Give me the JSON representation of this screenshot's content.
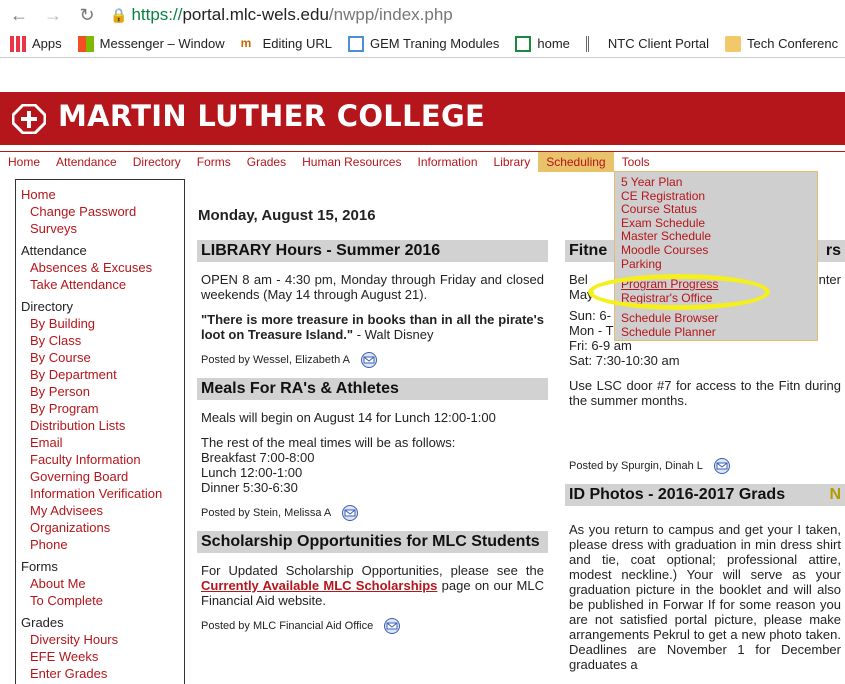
{
  "browser": {
    "url_scheme": "https://",
    "url_host": "portal.mlc-wels.edu",
    "url_path": "/nwpp/index.php",
    "bookmarks": [
      "Apps",
      "Messenger – Window",
      "Editing URL",
      "GEM Traning Modules",
      "home",
      "NTC Client Portal",
      "Tech Conferenc"
    ]
  },
  "site": {
    "name": "MARTIN LUTHER COLLEGE"
  },
  "topnav": [
    "Home",
    "Attendance",
    "Directory",
    "Forms",
    "Grades",
    "Human Resources",
    "Information",
    "Library",
    "Scheduling",
    "Tools"
  ],
  "dropdown": {
    "group1": [
      "5 Year Plan",
      "CE Registration",
      "Course Status",
      "Exam Schedule",
      "Master Schedule",
      "Moodle Courses",
      "Parking"
    ],
    "group2": [
      "Program Progress",
      "Registrar's Office"
    ],
    "group3": [
      "Schedule Browser",
      "Schedule Planner"
    ]
  },
  "leftmenu": {
    "home": "Home",
    "home_items": [
      "Change Password",
      "Surveys"
    ],
    "attendance": "Attendance",
    "attendance_items": [
      "Absences & Excuses",
      "Take Attendance"
    ],
    "directory": "Directory",
    "directory_items": [
      "By Building",
      "By Class",
      "By Course",
      "By Department",
      "By Person",
      "By Program",
      "Distribution Lists",
      "Email",
      "Faculty Information",
      "Governing Board",
      "Information Verification",
      "My Advisees",
      "Organizations",
      "Phone"
    ],
    "forms": "Forms",
    "forms_items": [
      "About Me",
      "To Complete"
    ],
    "grades": "Grades",
    "grades_items": [
      "Diversity Hours",
      "EFE Weeks",
      "Enter Grades"
    ]
  },
  "date": "Monday, August 15, 2016",
  "posts_left": {
    "library": {
      "title": "LIBRARY Hours - Summer 2016",
      "p1": "OPEN 8 am - 4:30 pm, Monday through Friday and closed weekends (May 14 through August 21).",
      "quote": "\"There is more treasure in books than in all the pirate's loot on Treasure Island.\"",
      "quote_author": " - Walt Disney",
      "posted": "Posted by Wessel, Elizabeth A"
    },
    "meals": {
      "title": "Meals For RA's & Athletes",
      "p1": "Meals will begin on August 14 for Lunch 12:00-1:00",
      "p2": "The rest of the meal times will be as follows:",
      "l1": "Breakfast  7:00-8:00",
      "l2": "Lunch  12:00-1:00",
      "l3": "Dinner  5:30-6:30",
      "posted": "Posted by Stein, Melissa A"
    },
    "scholar": {
      "title": "Scholarship Opportunities for MLC Students",
      "p_a": "For Updated Scholarship Opportunities, please see the ",
      "link": "Currently Available MLC Scholarships",
      "p_b": " page on our MLC Financial Aid website.",
      "posted": "Posted by MLC Financial Aid Office"
    }
  },
  "posts_right": {
    "fitness": {
      "title": "Fitne",
      "title_tail": "rs",
      "l1": "Bel",
      "l1_tail": "enter",
      "l2": "May",
      "sun": "Sun: 6-",
      "mon": "Mon - Thurs: 6-9 am & 6-9 pm",
      "fri": "Fri: 6-9 am",
      "sat": "Sat: 7:30-10:30 am",
      "p": "Use LSC door #7 for access to the Fitn during the summer months.",
      "posted": "Posted by Spurgin, Dinah L"
    },
    "id": {
      "title": "ID Photos - 2016-2017 Grads",
      "title_tail": "N",
      "p": "As you return to campus and get your I taken, please dress with graduation in min dress shirt and tie, coat optional; professional attire, modest neckline.) Your will serve as your graduation picture in the booklet and will also be published in Forwar If for some reason you are not satisfied portal picture, please make arrangements Pekrul to get a new photo taken. Deadlines are November 1 for December graduates a"
    }
  },
  "colors": {
    "brand": "#b5161b",
    "active_tab": "#e8c36b",
    "highlight": "#f5ef1c"
  }
}
